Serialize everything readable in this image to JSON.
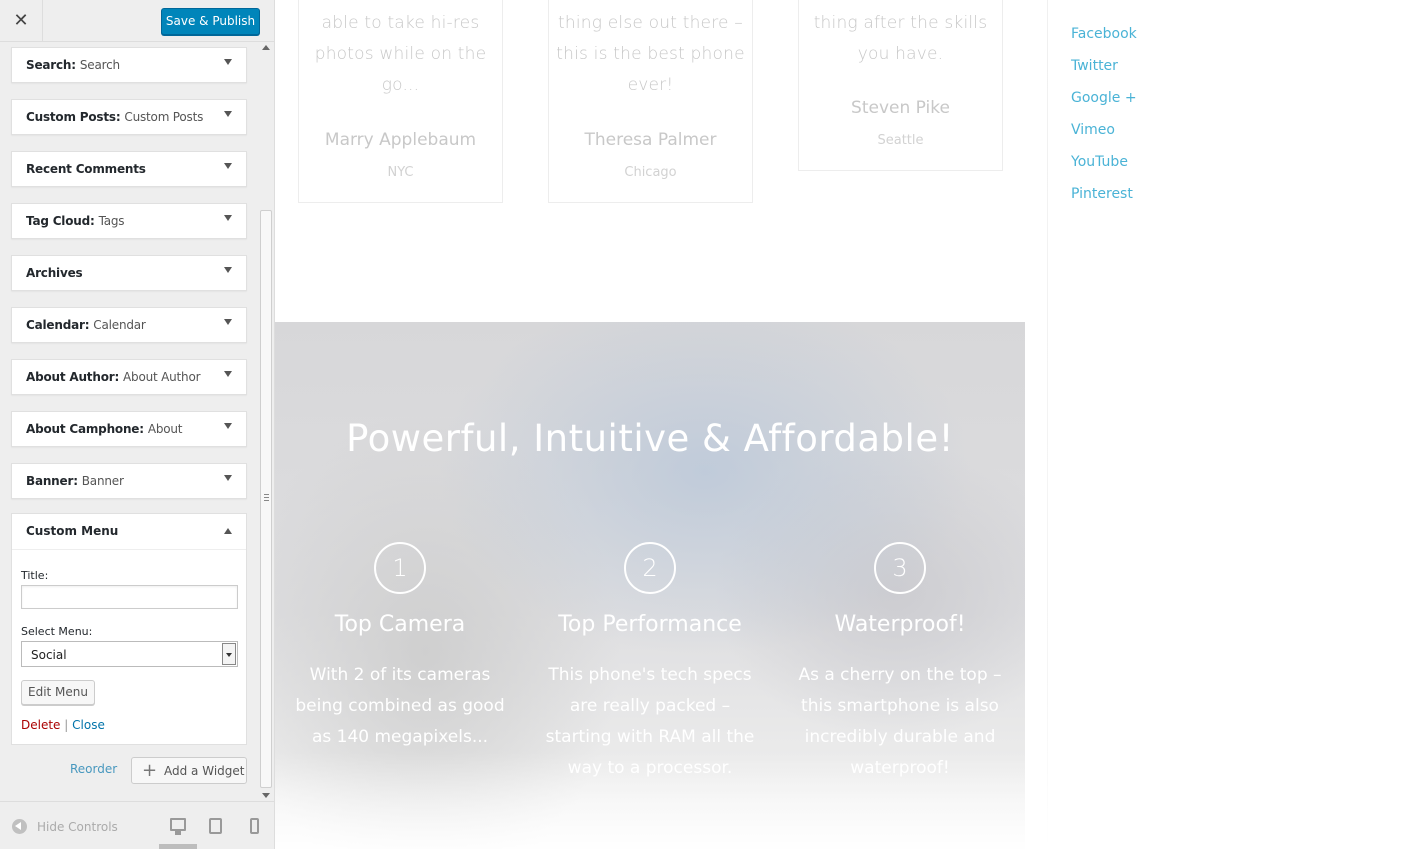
{
  "panel": {
    "close_icon": "close-icon",
    "save_label": "Save & Publish",
    "widgets": [
      {
        "name": "Search",
        "sub": "Search"
      },
      {
        "name": "Custom Posts",
        "sub": "Custom Posts"
      },
      {
        "name": "Recent Comments",
        "sub": ""
      },
      {
        "name": "Tag Cloud",
        "sub": "Tags"
      },
      {
        "name": "Archives",
        "sub": ""
      },
      {
        "name": "Calendar",
        "sub": "Calendar"
      },
      {
        "name": "About Author",
        "sub": "About Author"
      },
      {
        "name": "About Camphone",
        "sub": "About"
      },
      {
        "name": "Banner",
        "sub": "Banner"
      }
    ],
    "custom_menu": {
      "title": "Custom Menu",
      "title_label": "Title:",
      "title_value": "",
      "select_label": "Select Menu:",
      "select_value": "Social",
      "edit_label": "Edit Menu",
      "delete_label": "Delete",
      "separator": "|",
      "close_label": "Close"
    },
    "reorder_label": "Reorder",
    "add_widget_plus": "+",
    "add_widget_label": "Add a Widget",
    "hide_controls_label": "Hide Controls"
  },
  "preview": {
    "testimonials": [
      {
        "quote": [
          "able to take hi-res",
          "photos while on the",
          "go..."
        ],
        "name": "Marry Applebaum",
        "city": "NYC"
      },
      {
        "quote": [
          "thing else out there –",
          "this is the best phone",
          "ever!"
        ],
        "name": "Theresa Palmer",
        "city": "Chicago"
      },
      {
        "quote": [
          "thing after the skills",
          "you have."
        ],
        "name": "Steven Pike",
        "city": "Seattle"
      }
    ],
    "hero_title": "Powerful, Intuitive & Affordable!",
    "features": [
      {
        "num": "1",
        "title": "Top Camera",
        "desc": [
          "With 2 of its cameras",
          "being combined as good",
          "as 140 megapixels..."
        ]
      },
      {
        "num": "2",
        "title": "Top Performance",
        "desc": [
          "This phone's tech specs",
          "are really packed –",
          "starting with RAM all the",
          "way to a processor."
        ]
      },
      {
        "num": "3",
        "title": "Waterproof!",
        "desc": [
          "As a cherry on the top –",
          "this smartphone is also",
          "incredibly durable and",
          "waterproof!"
        ]
      }
    ],
    "social_links": [
      "Facebook",
      "Twitter",
      "Google +",
      "Vimeo",
      "YouTube",
      "Pinterest"
    ],
    "link_color": "#4ab3d6"
  }
}
